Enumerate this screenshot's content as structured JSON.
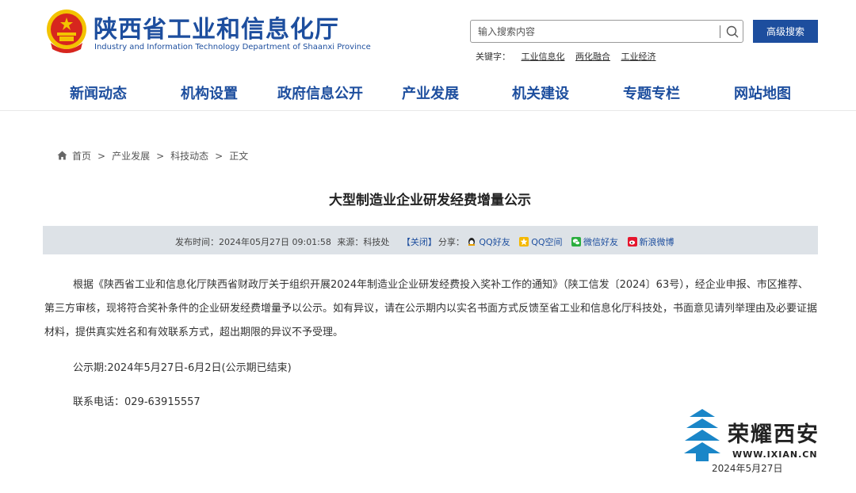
{
  "header": {
    "brand_cn": "陕西省工业和信息化厅",
    "brand_en": "Industry and Information Technology Department of Shaanxi Province",
    "search_placeholder": "输入搜索内容",
    "advanced_search": "高级搜索",
    "keywords_label": "关键字：",
    "keywords": [
      "工业信息化",
      "两化融合",
      "工业经济"
    ]
  },
  "nav": [
    "新闻动态",
    "机构设置",
    "政府信息公开",
    "产业发展",
    "机关建设",
    "专题专栏",
    "网站地图"
  ],
  "breadcrumb": {
    "items": [
      "首页",
      "产业发展",
      "科技动态",
      "正文"
    ],
    "separator": ">"
  },
  "article": {
    "title": "大型制造业企业研发经费增量公示",
    "meta": {
      "published_label": "发布时间：",
      "published": "2024年05月27日 09:01:58",
      "source_label": "来源：",
      "source": "科技处",
      "close": "【关闭】",
      "share_label": "分享：",
      "share": [
        "QQ好友",
        "QQ空间",
        "微信好友",
        "新浪微博"
      ]
    },
    "paragraph": "根据《陕西省工业和信息化厅陕西省财政厅关于组织开展2024年制造业企业研发经费投入奖补工作的通知》（陕工信发〔2024〕63号），经企业申报、市区推荐、第三方审核，现将符合奖补条件的企业研发经费增量予以公示。如有异议，请在公示期内以实名书面方式反馈至省工业和信息化厅科技处，书面意见请列举理由及必要证据材料，提供真实姓名和有效联系方式，超出期限的异议不予受理。",
    "period": "公示期:2024年5月27日-6月2日(公示期已结束)",
    "phone": "联系电话：029-63915557"
  },
  "watermark": {
    "brand": "荣耀西安",
    "url": "WWW.IXIAN.CN",
    "date": "2024年5月27日"
  },
  "colors": {
    "primary": "#1d4e9e",
    "meta_bar": "#dde2e7",
    "emblem_red": "#d7261e",
    "emblem_gold": "#f3c300"
  }
}
